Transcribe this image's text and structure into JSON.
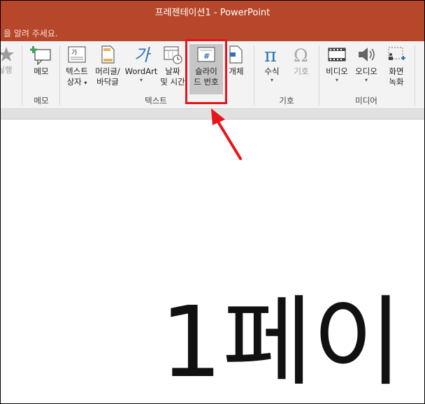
{
  "window": {
    "title": "프레젠테이션1 - PowerPoint"
  },
  "tell_me": {
    "text": "을 알려 주세요."
  },
  "ribbon": {
    "partial_left_label": "실행",
    "memo_group": {
      "label": "메모",
      "button": "메모"
    },
    "text_group": {
      "label": "텍스트",
      "buttons": [
        {
          "line1": "텍스트",
          "line2": "상자"
        },
        {
          "line1": "머리글/",
          "line2": "바닥글"
        },
        {
          "line1": "WordArt",
          "line2": ""
        },
        {
          "line1": "날짜",
          "line2": "및 시간"
        },
        {
          "line1": "슬라이",
          "line2": "드 번호"
        },
        {
          "line1": "개체",
          "line2": ""
        }
      ]
    },
    "symbol_group": {
      "label": "기호",
      "buttons": [
        {
          "line1": "수식"
        },
        {
          "line1": "기호"
        }
      ]
    },
    "media_group": {
      "label": "미디어",
      "buttons": [
        {
          "line1": "비디오"
        },
        {
          "line1": "오디오"
        },
        {
          "line1": "화면",
          "line2": "녹화"
        }
      ]
    }
  },
  "slide": {
    "text": "1페이"
  },
  "colors": {
    "title_bar": "#b7472a",
    "highlight": "#e8141b",
    "ribbon_bg": "#f3f3f3"
  }
}
